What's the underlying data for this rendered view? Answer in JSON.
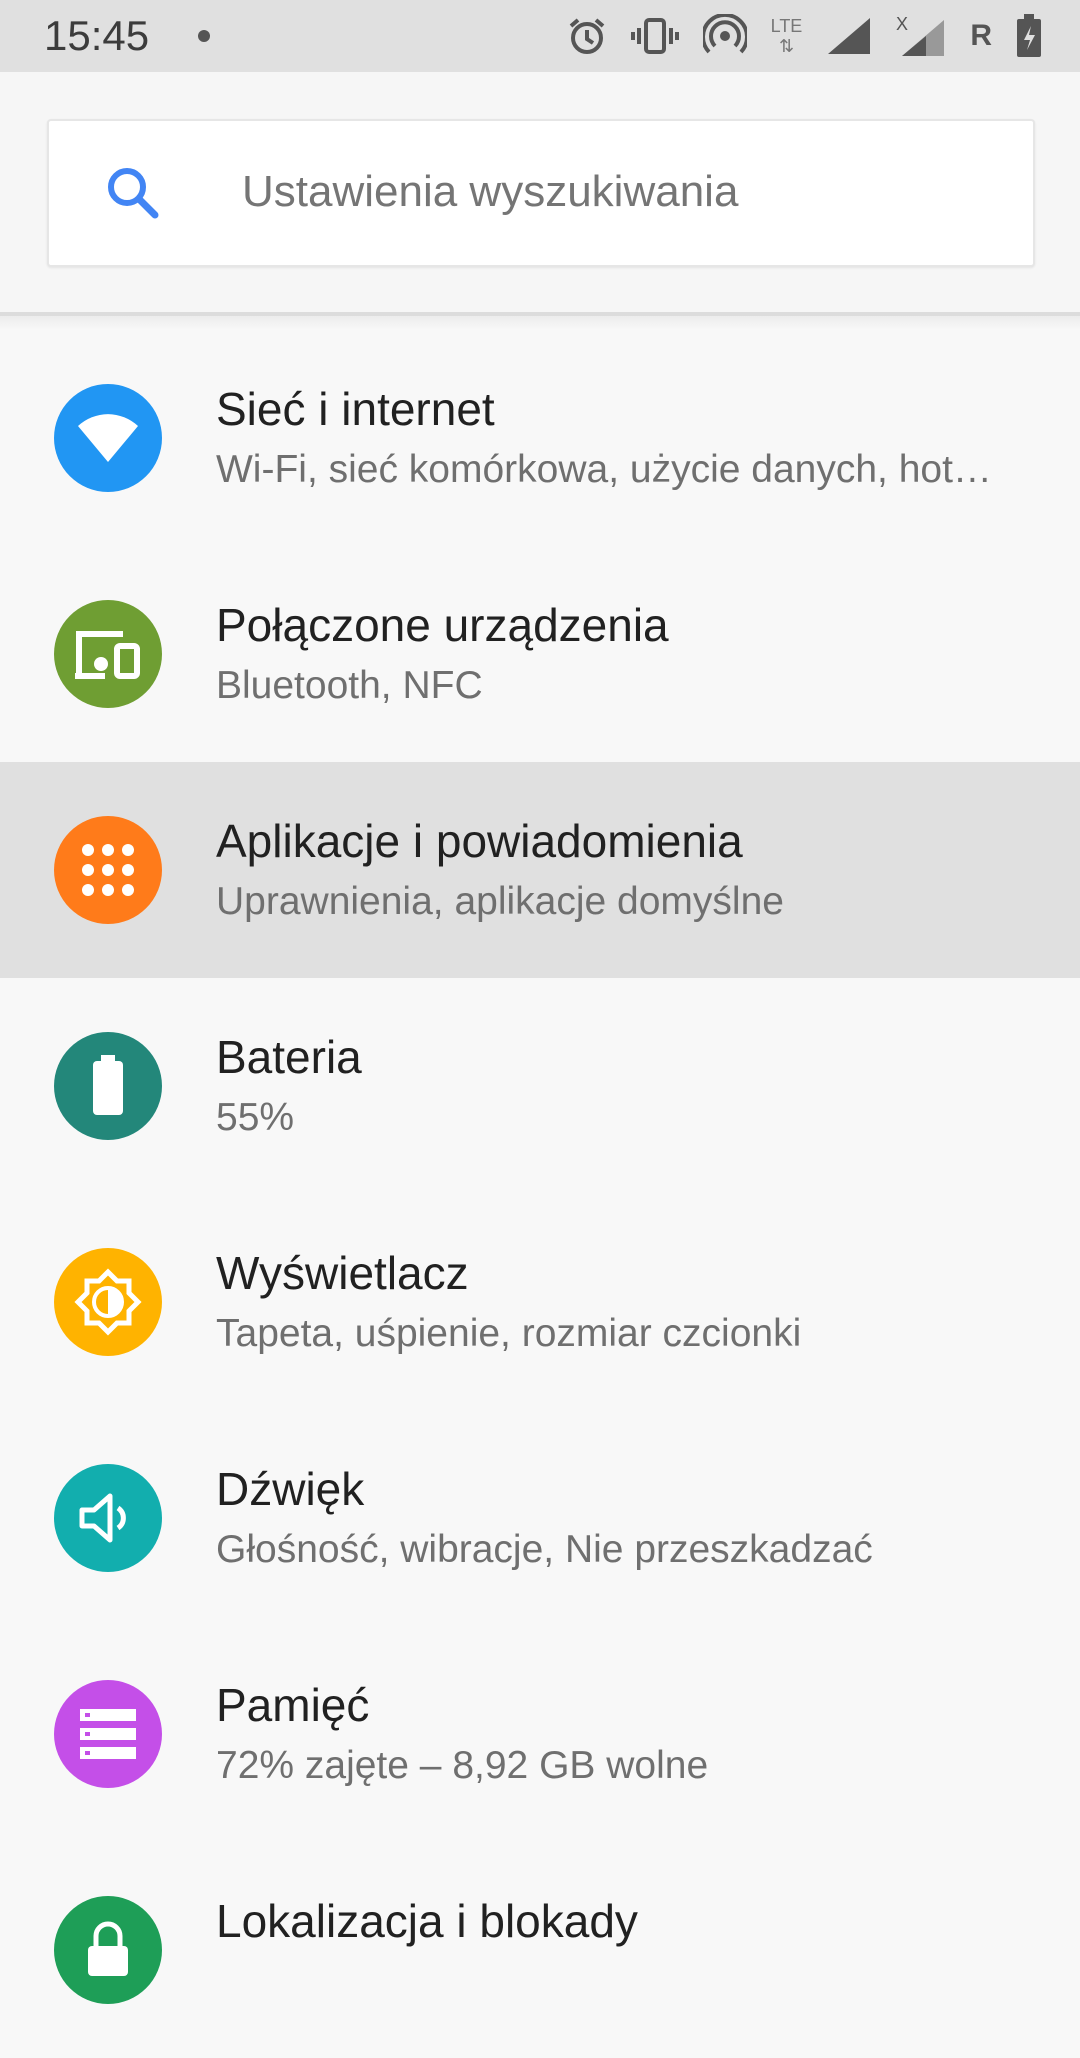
{
  "status_bar": {
    "time": "15:45",
    "lte_label": "LTE",
    "roaming_label": "R",
    "icons": [
      "notification-dot-icon",
      "alarm-icon",
      "vibrate-icon",
      "hotspot-icon",
      "lte-data-icon",
      "signal-icon",
      "signal-no-data-icon",
      "battery-charging-icon"
    ]
  },
  "search": {
    "placeholder": "Ustawienia wyszukiwania",
    "icon": "search-icon",
    "icon_color": "#4285f4"
  },
  "items": [
    {
      "title": "Sieć i internet",
      "summary": "Wi-Fi, sieć komórkowa, użycie danych, hot…",
      "icon": "wifi-icon",
      "color": "#2196f3"
    },
    {
      "title": "Połączone urządzenia",
      "summary": "Bluetooth, NFC",
      "icon": "devices-icon",
      "color": "#6f9e33"
    },
    {
      "title": "Aplikacje i powiadomienia",
      "summary": "Uprawnienia, aplikacje domyślne",
      "icon": "apps-icon",
      "color": "#ff7b1a",
      "selected": true
    },
    {
      "title": "Bateria",
      "summary": "55%",
      "icon": "battery-icon",
      "color": "#23877a"
    },
    {
      "title": "Wyświetlacz",
      "summary": "Tapeta, uśpienie, rozmiar czcionki",
      "icon": "brightness-icon",
      "color": "#ffb300"
    },
    {
      "title": "Dźwięk",
      "summary": "Głośność, wibracje, Nie przeszkadzać",
      "icon": "volume-icon",
      "color": "#12aeae"
    },
    {
      "title": "Pamięć",
      "summary": "72% zajęte – 8,92 GB wolne",
      "icon": "storage-icon",
      "color": "#c44fe8"
    },
    {
      "title": "Lokalizacja i blokady",
      "summary": "",
      "icon": "lock-icon",
      "color": "#1e9e57"
    }
  ]
}
